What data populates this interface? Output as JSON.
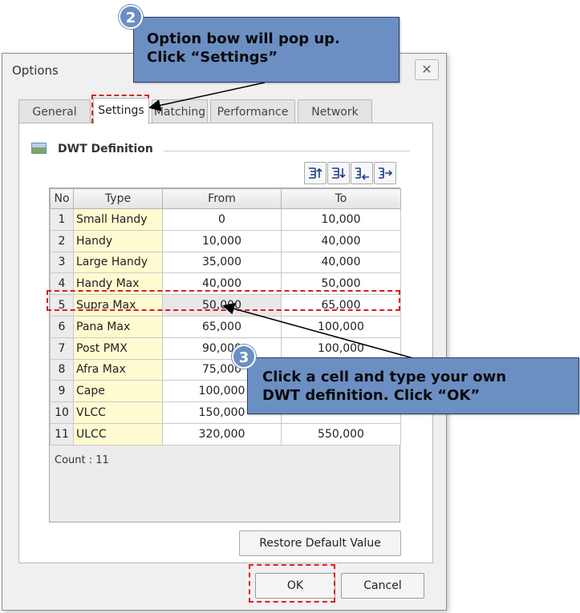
{
  "window": {
    "title": "Options",
    "close_symbol": "✕"
  },
  "tabs": [
    {
      "label": "General",
      "active": false
    },
    {
      "label": "Settings",
      "active": true
    },
    {
      "label": "Matching",
      "active": false
    },
    {
      "label": "Performance",
      "active": false
    },
    {
      "label": "Network",
      "active": false
    }
  ],
  "group": {
    "title": "DWT Definition",
    "icon": "image-icon"
  },
  "toolbar": {
    "icons": [
      "align-top-icon",
      "align-bottom-icon",
      "align-left-icon",
      "align-right-icon"
    ]
  },
  "table": {
    "headers": [
      "No",
      "Type",
      "From",
      "To"
    ],
    "rows": [
      {
        "no": "1",
        "type": "Small Handy",
        "from": "0",
        "to": "10,000"
      },
      {
        "no": "2",
        "type": "Handy",
        "from": "10,000",
        "to": "40,000"
      },
      {
        "no": "3",
        "type": "Large Handy",
        "from": "35,000",
        "to": "40,000"
      },
      {
        "no": "4",
        "type": "Handy Max",
        "from": "40,000",
        "to": "50,000"
      },
      {
        "no": "5",
        "type": "Supra Max",
        "from": "50,000",
        "to": "65,000"
      },
      {
        "no": "6",
        "type": "Pana Max",
        "from": "65,000",
        "to": "100,000"
      },
      {
        "no": "7",
        "type": "Post PMX",
        "from": "90,000",
        "to": "100,000"
      },
      {
        "no": "8",
        "type": "Afra Max",
        "from": "75,000",
        "to": ""
      },
      {
        "no": "9",
        "type": "Cape",
        "from": "100,000",
        "to": ""
      },
      {
        "no": "10",
        "type": "VLCC",
        "from": "150,000",
        "to": ""
      },
      {
        "no": "11",
        "type": "ULCC",
        "from": "320,000",
        "to": "550,000"
      }
    ],
    "count_label": "Count : 11"
  },
  "buttons": {
    "restore": "Restore Default Value",
    "ok": "OK",
    "cancel": "Cancel"
  },
  "callouts": {
    "step2": {
      "number": "2",
      "line1": "Option bow will pop up.",
      "line2": "Click “Settings”"
    },
    "step3": {
      "number": "3",
      "line1": "Click a cell and type your own",
      "line2": "DWT definition. Click “OK”"
    }
  },
  "colors": {
    "callout_fill": "#6b8fc2",
    "highlight_dash": "#e0191f",
    "type_column": "#fffbd0"
  }
}
